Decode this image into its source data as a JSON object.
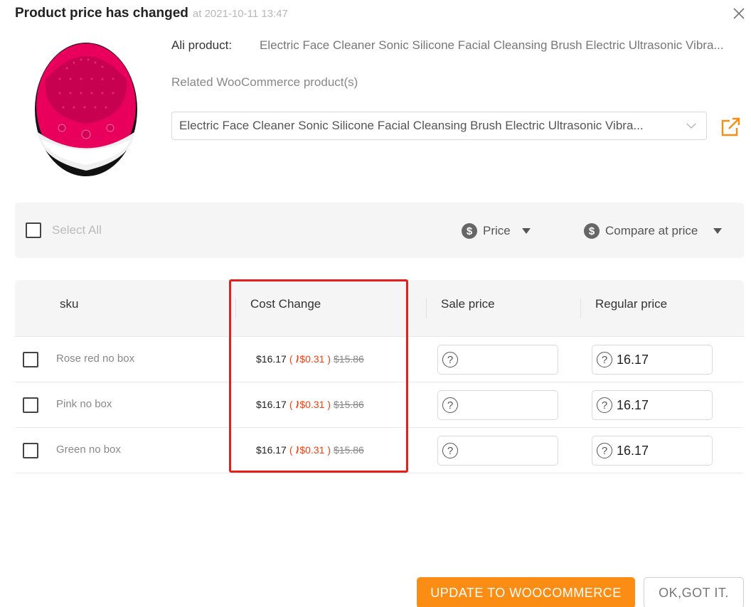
{
  "header": {
    "title": "Product price has changed",
    "timestamp": "at 2021-10-11 13:47"
  },
  "product": {
    "ali_label": "Ali product:",
    "ali_name": "Electric Face Cleaner Sonic Silicone Facial Cleansing Brush Electric Ultrasonic Vibra...",
    "related_label": "Related WooCommerce product(s)",
    "related_value": "Electric Face Cleaner Sonic Silicone Facial Cleansing Brush Electric Ultrasonic Vibra...",
    "image_icon": "face-cleansing-brush-image"
  },
  "toolbar": {
    "select_all_label": "Select All",
    "price_label": "Price",
    "compare_label": "Compare at price",
    "price_icon": "dollar-circle-icon"
  },
  "table": {
    "columns": [
      "sku",
      "Cost Change",
      "Sale price",
      "Regular price"
    ],
    "rows": [
      {
        "sku": "Rose red no box",
        "cost_new": "$16.17",
        "cost_change_open": "(",
        "cost_change": "$0.31",
        "cost_change_close": ")",
        "cost_old": "$15.86",
        "sale_price": "",
        "regular_price": "16.17"
      },
      {
        "sku": "Pink no box",
        "cost_new": "$16.17",
        "cost_change_open": "(",
        "cost_change": "$0.31",
        "cost_change_close": ")",
        "cost_old": "$15.86",
        "sale_price": "",
        "regular_price": "16.17"
      },
      {
        "sku": "Green no box",
        "cost_new": "$16.17",
        "cost_change_open": "(",
        "cost_change": "$0.31",
        "cost_change_close": ")",
        "cost_old": "$15.86",
        "sale_price": "",
        "regular_price": "16.17"
      }
    ]
  },
  "buttons": {
    "update_label": "UPDATE TO WOOCOMMERCE",
    "ok_label": "OK,GOT IT."
  },
  "colors": {
    "accent": "#fb8c14",
    "price_increase": "#f5410f",
    "highlight": "#e41e1e"
  }
}
